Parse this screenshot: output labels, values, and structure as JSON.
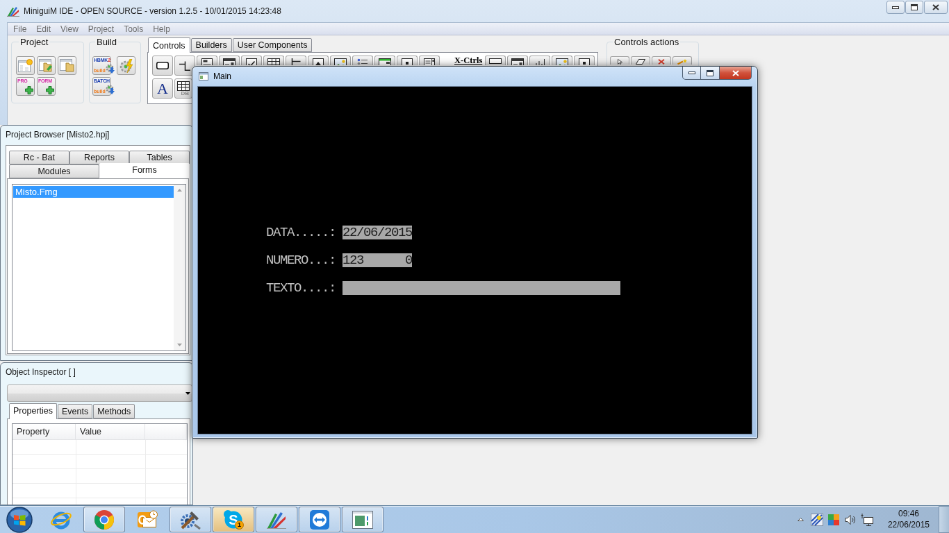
{
  "window": {
    "title": "MiniguiM IDE - OPEN SOURCE - version 1.2.5 - 10/01/2015 14:23:48"
  },
  "menu": [
    "File",
    "Edit",
    "View",
    "Project",
    "Tools",
    "Help"
  ],
  "toolbar": {
    "project_group": {
      "title": "Project",
      "buttons": [
        {
          "kind": "new"
        },
        {
          "kind": "open"
        },
        {
          "kind": "close"
        },
        {
          "kind": "add",
          "label": "PRG"
        },
        {
          "kind": "add",
          "label": "FORM"
        }
      ]
    },
    "build_group": {
      "title": "Build",
      "buttons": [
        {
          "kind": "build",
          "label": "HBMK",
          "badge": "2",
          "caption": "build"
        },
        {
          "kind": "run"
        },
        {
          "kind": "build",
          "label": "BATCH",
          "caption": "build"
        }
      ]
    },
    "palette": {
      "tabs": [
        {
          "label": "Controls",
          "selected": true
        },
        {
          "label": "Builders",
          "selected": false
        },
        {
          "label": "User Components",
          "selected": false
        }
      ],
      "row_1": [
        {
          "kind": "roundrect"
        },
        {
          "kind": "stepline"
        },
        {
          "kind": "form"
        },
        {
          "kind": "dropdown"
        },
        {
          "kind": "checkbox"
        },
        {
          "kind": "table"
        },
        {
          "kind": "bracket"
        },
        {
          "kind": "uparrow"
        },
        {
          "kind": "picture"
        },
        {
          "kind": "dots"
        },
        {
          "kind": "greenbar"
        },
        {
          "kind": "dotbox"
        },
        {
          "kind": "scrollwin"
        }
      ],
      "group_label": "X-Ctrls",
      "row_1_extra": [
        {
          "kind": "flatrect"
        },
        {
          "kind": "dropdown"
        },
        {
          "kind": "ticks"
        },
        {
          "kind": "picture"
        },
        {
          "kind": "dotbox"
        }
      ],
      "row_2": [
        {
          "kind": "glyph",
          "glyph": "A"
        },
        {
          "kind": "grid",
          "caption": "DB"
        }
      ]
    },
    "actions_group": {
      "title": "Controls actions",
      "buttons": [
        {
          "kind": "pointer"
        },
        {
          "kind": "eraser"
        },
        {
          "kind": "cut"
        },
        {
          "kind": "wand"
        }
      ]
    }
  },
  "project_browser": {
    "title": "Project Browser [Misto2.hpj]",
    "tab_rows": [
      {
        "tabs": [
          {
            "label": "Rc - Bat",
            "selected": false
          },
          {
            "label": "Reports",
            "selected": false
          },
          {
            "label": "Tables",
            "selected": false
          }
        ]
      },
      {
        "tabs": [
          {
            "label": "Modules",
            "selected": false
          },
          {
            "label": "Forms",
            "selected": true
          }
        ]
      }
    ],
    "files": [
      {
        "label": "Misto.Fmg",
        "selected": true
      }
    ]
  },
  "object_inspector": {
    "title": "Object Inspector [ ]",
    "tabs": [
      {
        "label": "Properties",
        "selected": true
      },
      {
        "label": "Events",
        "selected": false
      },
      {
        "label": "Methods",
        "selected": false
      }
    ],
    "grid": {
      "columns": [
        "Property",
        "Value"
      ]
    }
  },
  "main_window": {
    "title": "Main",
    "fields": [
      {
        "kind": "date",
        "label": "DATA.....:",
        "value": "22/06/2015"
      },
      {
        "kind": "number",
        "label": "NUMERO...:",
        "value": "123      0"
      },
      {
        "kind": "text",
        "label": "TEXTO....:"
      }
    ]
  },
  "taskbar": {
    "items": [
      {
        "kind": "ering",
        "running": false,
        "flashing": false
      },
      {
        "kind": "tricircle",
        "running": true,
        "flashing": false
      },
      {
        "kind": "mailclock",
        "running": false,
        "flashing": false
      },
      {
        "kind": "tools",
        "running": true,
        "flashing": false
      },
      {
        "kind": "chat",
        "glyph": "S",
        "badge": "1",
        "running": true,
        "flashing": true
      },
      {
        "kind": "fan",
        "running": true,
        "flashing": false
      },
      {
        "kind": "arrows",
        "running": true,
        "flashing": false
      },
      {
        "kind": "appwindow",
        "running": true,
        "flashing": false
      }
    ],
    "tray": {
      "time": "09:46",
      "date": "22/06/2015"
    }
  }
}
